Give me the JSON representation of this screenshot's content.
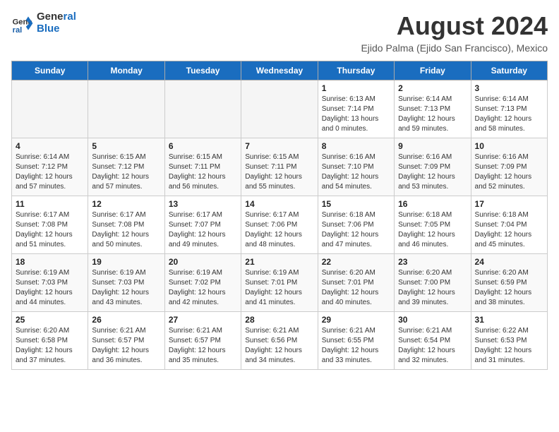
{
  "header": {
    "logo_line1": "General",
    "logo_line2": "Blue",
    "main_title": "August 2024",
    "subtitle": "Ejido Palma (Ejido San Francisco), Mexico"
  },
  "calendar": {
    "days_of_week": [
      "Sunday",
      "Monday",
      "Tuesday",
      "Wednesday",
      "Thursday",
      "Friday",
      "Saturday"
    ],
    "weeks": [
      [
        {
          "day": "",
          "info": ""
        },
        {
          "day": "",
          "info": ""
        },
        {
          "day": "",
          "info": ""
        },
        {
          "day": "",
          "info": ""
        },
        {
          "day": "1",
          "info": "Sunrise: 6:13 AM\nSunset: 7:14 PM\nDaylight: 13 hours\nand 0 minutes."
        },
        {
          "day": "2",
          "info": "Sunrise: 6:14 AM\nSunset: 7:13 PM\nDaylight: 12 hours\nand 59 minutes."
        },
        {
          "day": "3",
          "info": "Sunrise: 6:14 AM\nSunset: 7:13 PM\nDaylight: 12 hours\nand 58 minutes."
        }
      ],
      [
        {
          "day": "4",
          "info": "Sunrise: 6:14 AM\nSunset: 7:12 PM\nDaylight: 12 hours\nand 57 minutes."
        },
        {
          "day": "5",
          "info": "Sunrise: 6:15 AM\nSunset: 7:12 PM\nDaylight: 12 hours\nand 57 minutes."
        },
        {
          "day": "6",
          "info": "Sunrise: 6:15 AM\nSunset: 7:11 PM\nDaylight: 12 hours\nand 56 minutes."
        },
        {
          "day": "7",
          "info": "Sunrise: 6:15 AM\nSunset: 7:11 PM\nDaylight: 12 hours\nand 55 minutes."
        },
        {
          "day": "8",
          "info": "Sunrise: 6:16 AM\nSunset: 7:10 PM\nDaylight: 12 hours\nand 54 minutes."
        },
        {
          "day": "9",
          "info": "Sunrise: 6:16 AM\nSunset: 7:09 PM\nDaylight: 12 hours\nand 53 minutes."
        },
        {
          "day": "10",
          "info": "Sunrise: 6:16 AM\nSunset: 7:09 PM\nDaylight: 12 hours\nand 52 minutes."
        }
      ],
      [
        {
          "day": "11",
          "info": "Sunrise: 6:17 AM\nSunset: 7:08 PM\nDaylight: 12 hours\nand 51 minutes."
        },
        {
          "day": "12",
          "info": "Sunrise: 6:17 AM\nSunset: 7:08 PM\nDaylight: 12 hours\nand 50 minutes."
        },
        {
          "day": "13",
          "info": "Sunrise: 6:17 AM\nSunset: 7:07 PM\nDaylight: 12 hours\nand 49 minutes."
        },
        {
          "day": "14",
          "info": "Sunrise: 6:17 AM\nSunset: 7:06 PM\nDaylight: 12 hours\nand 48 minutes."
        },
        {
          "day": "15",
          "info": "Sunrise: 6:18 AM\nSunset: 7:06 PM\nDaylight: 12 hours\nand 47 minutes."
        },
        {
          "day": "16",
          "info": "Sunrise: 6:18 AM\nSunset: 7:05 PM\nDaylight: 12 hours\nand 46 minutes."
        },
        {
          "day": "17",
          "info": "Sunrise: 6:18 AM\nSunset: 7:04 PM\nDaylight: 12 hours\nand 45 minutes."
        }
      ],
      [
        {
          "day": "18",
          "info": "Sunrise: 6:19 AM\nSunset: 7:03 PM\nDaylight: 12 hours\nand 44 minutes."
        },
        {
          "day": "19",
          "info": "Sunrise: 6:19 AM\nSunset: 7:03 PM\nDaylight: 12 hours\nand 43 minutes."
        },
        {
          "day": "20",
          "info": "Sunrise: 6:19 AM\nSunset: 7:02 PM\nDaylight: 12 hours\nand 42 minutes."
        },
        {
          "day": "21",
          "info": "Sunrise: 6:19 AM\nSunset: 7:01 PM\nDaylight: 12 hours\nand 41 minutes."
        },
        {
          "day": "22",
          "info": "Sunrise: 6:20 AM\nSunset: 7:01 PM\nDaylight: 12 hours\nand 40 minutes."
        },
        {
          "day": "23",
          "info": "Sunrise: 6:20 AM\nSunset: 7:00 PM\nDaylight: 12 hours\nand 39 minutes."
        },
        {
          "day": "24",
          "info": "Sunrise: 6:20 AM\nSunset: 6:59 PM\nDaylight: 12 hours\nand 38 minutes."
        }
      ],
      [
        {
          "day": "25",
          "info": "Sunrise: 6:20 AM\nSunset: 6:58 PM\nDaylight: 12 hours\nand 37 minutes."
        },
        {
          "day": "26",
          "info": "Sunrise: 6:21 AM\nSunset: 6:57 PM\nDaylight: 12 hours\nand 36 minutes."
        },
        {
          "day": "27",
          "info": "Sunrise: 6:21 AM\nSunset: 6:57 PM\nDaylight: 12 hours\nand 35 minutes."
        },
        {
          "day": "28",
          "info": "Sunrise: 6:21 AM\nSunset: 6:56 PM\nDaylight: 12 hours\nand 34 minutes."
        },
        {
          "day": "29",
          "info": "Sunrise: 6:21 AM\nSunset: 6:55 PM\nDaylight: 12 hours\nand 33 minutes."
        },
        {
          "day": "30",
          "info": "Sunrise: 6:21 AM\nSunset: 6:54 PM\nDaylight: 12 hours\nand 32 minutes."
        },
        {
          "day": "31",
          "info": "Sunrise: 6:22 AM\nSunset: 6:53 PM\nDaylight: 12 hours\nand 31 minutes."
        }
      ]
    ]
  }
}
